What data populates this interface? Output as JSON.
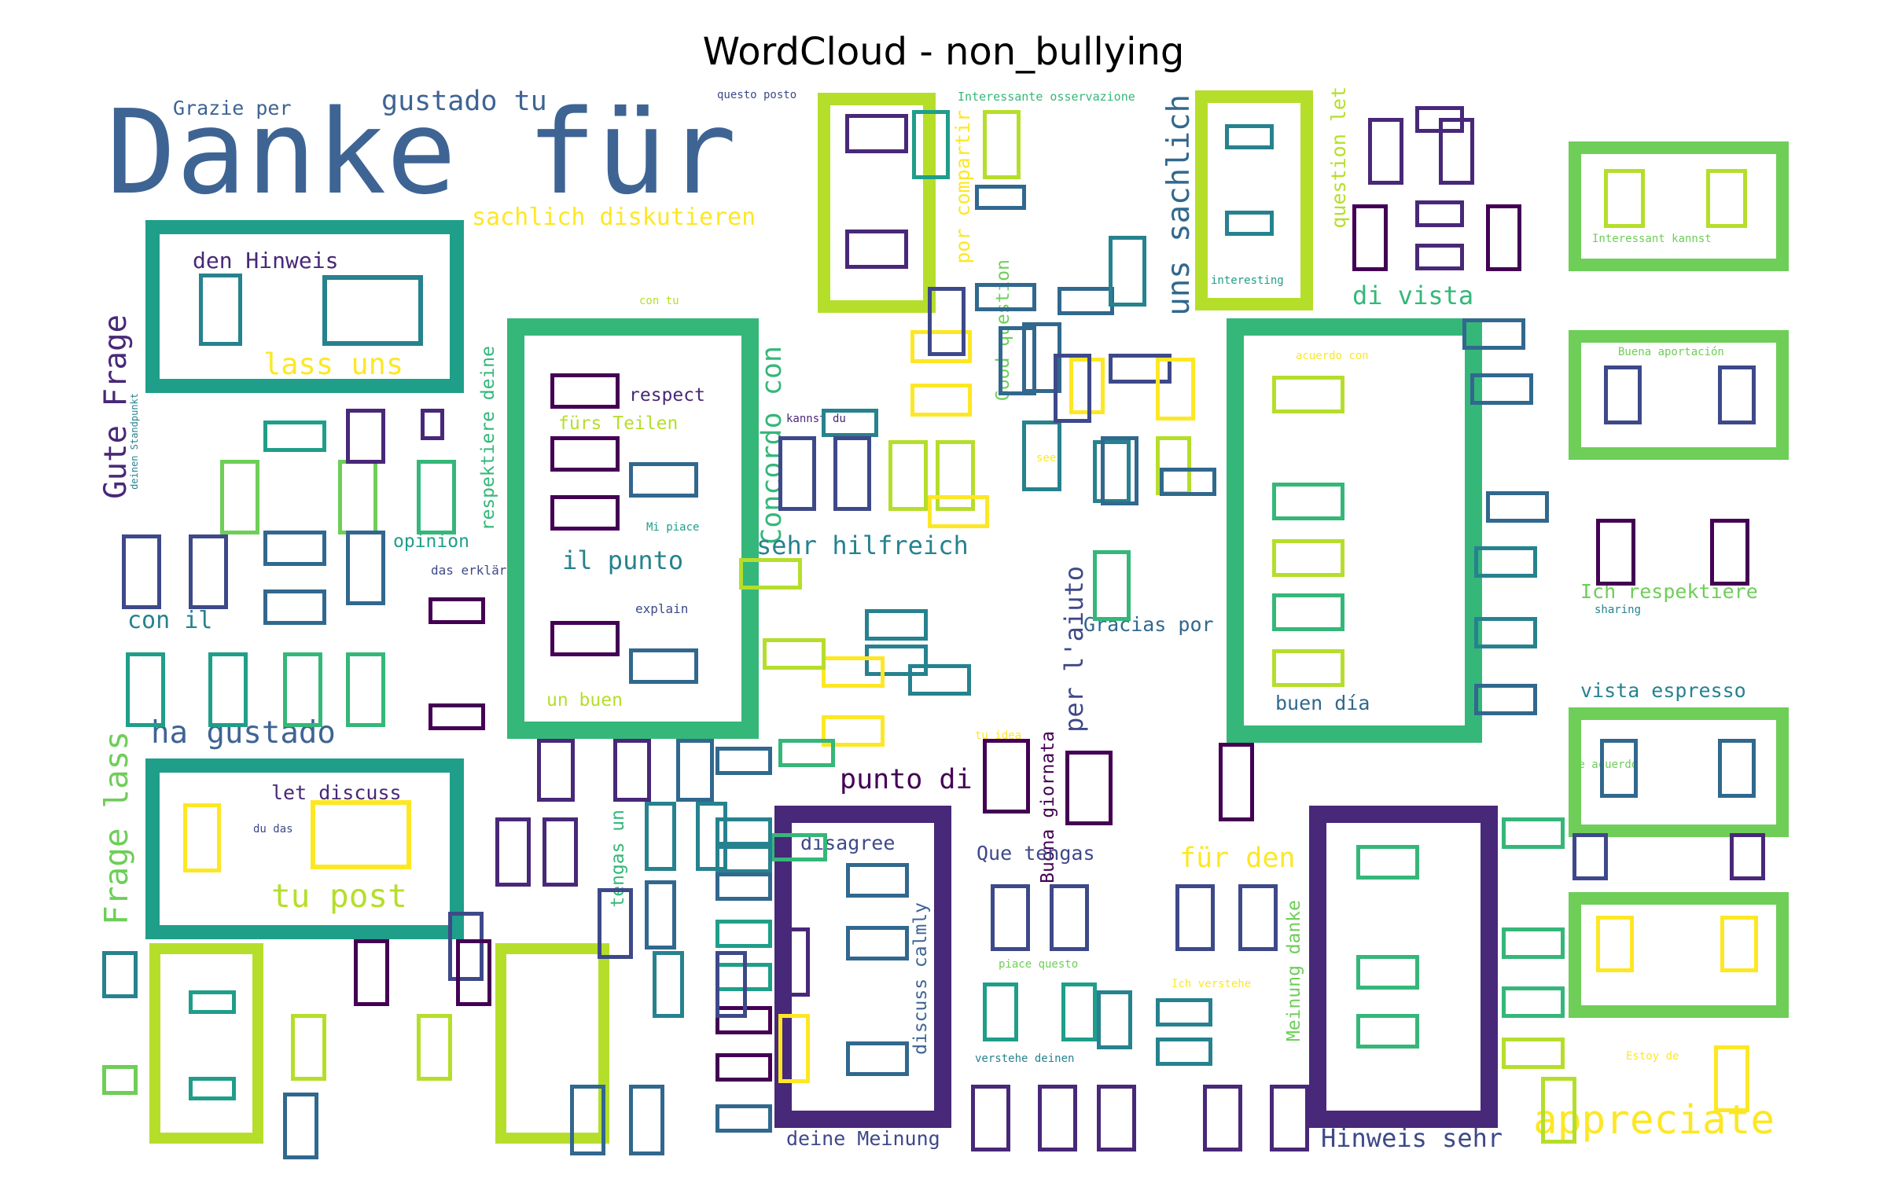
{
  "chart_data": {
    "type": "wordcloud",
    "title": "WordCloud - non_bullying",
    "palette": [
      "#440154",
      "#482878",
      "#3e4989",
      "#31688e",
      "#26828e",
      "#1f9e89",
      "#35b779",
      "#6ece58",
      "#b5de2b",
      "#fde725"
    ],
    "words": [
      {
        "text": "Danke für",
        "weight": 100,
        "color": "#3e6494",
        "orientation": "h"
      },
      {
        "text": "gustado tu",
        "weight": 30,
        "color": "#3e6494",
        "orientation": "h"
      },
      {
        "text": "Grazie per",
        "weight": 22,
        "color": "#3e6494",
        "orientation": "h"
      },
      {
        "text": "sachlich diskutieren",
        "weight": 26,
        "color": "#fde725",
        "orientation": "h"
      },
      {
        "text": "den Hinweis",
        "weight": 24,
        "color": "#482878",
        "orientation": "h"
      },
      {
        "text": "lass uns",
        "weight": 32,
        "color": "#fde725",
        "orientation": "h"
      },
      {
        "text": "Gute Frage",
        "weight": 34,
        "color": "#482878",
        "orientation": "v"
      },
      {
        "text": "respect",
        "weight": 20,
        "color": "#482878",
        "orientation": "h"
      },
      {
        "text": "fürs Teilen",
        "weight": 20,
        "color": "#b5de2b",
        "orientation": "h"
      },
      {
        "text": "Concordo con",
        "weight": 30,
        "color": "#35b779",
        "orientation": "v"
      },
      {
        "text": "il punto",
        "weight": 28,
        "color": "#26828e",
        "orientation": "h"
      },
      {
        "text": "sehr hilfreich",
        "weight": 28,
        "color": "#26828e",
        "orientation": "h"
      },
      {
        "text": "uns sachlich",
        "weight": 34,
        "color": "#31688e",
        "orientation": "v"
      },
      {
        "text": "di vista",
        "weight": 28,
        "color": "#35b779",
        "orientation": "h"
      },
      {
        "text": "question let",
        "weight": 22,
        "color": "#b5de2b",
        "orientation": "v"
      },
      {
        "text": "por compartir",
        "weight": 22,
        "color": "#fde725",
        "orientation": "v"
      },
      {
        "text": "Good question",
        "weight": 20,
        "color": "#6ece58",
        "orientation": "v"
      },
      {
        "text": "respektiere deine",
        "weight": 20,
        "color": "#35b779",
        "orientation": "v"
      },
      {
        "text": "opinion",
        "weight": 20,
        "color": "#1f9e89",
        "orientation": "h"
      },
      {
        "text": "con il",
        "weight": 26,
        "color": "#26828e",
        "orientation": "h"
      },
      {
        "text": "ha gustado",
        "weight": 34,
        "color": "#3e6494",
        "orientation": "h"
      },
      {
        "text": "Frage lass",
        "weight": 36,
        "color": "#6ece58",
        "orientation": "v"
      },
      {
        "text": "let discuss",
        "weight": 22,
        "color": "#482878",
        "orientation": "h"
      },
      {
        "text": "tu post",
        "weight": 36,
        "color": "#b5de2b",
        "orientation": "h"
      },
      {
        "text": "un buen",
        "weight": 20,
        "color": "#b5de2b",
        "orientation": "h"
      },
      {
        "text": "punto di",
        "weight": 30,
        "color": "#440154",
        "orientation": "h"
      },
      {
        "text": "per l'aiuto",
        "weight": 28,
        "color": "#3e4989",
        "orientation": "v"
      },
      {
        "text": "Gracias por",
        "weight": 22,
        "color": "#31688e",
        "orientation": "h"
      },
      {
        "text": "Buona giornata",
        "weight": 20,
        "color": "#440154",
        "orientation": "v"
      },
      {
        "text": "Que tengas",
        "weight": 22,
        "color": "#3e4989",
        "orientation": "h"
      },
      {
        "text": "für den",
        "weight": 30,
        "color": "#fde725",
        "orientation": "h"
      },
      {
        "text": "disagree",
        "weight": 22,
        "color": "#3e4989",
        "orientation": "h"
      },
      {
        "text": "discuss calmly",
        "weight": 20,
        "color": "#3e6494",
        "orientation": "v"
      },
      {
        "text": "tengas un",
        "weight": 20,
        "color": "#35b779",
        "orientation": "v"
      },
      {
        "text": "Meinung danke",
        "weight": 20,
        "color": "#6ece58",
        "orientation": "v"
      },
      {
        "text": "deine Meinung",
        "weight": 22,
        "color": "#3e4989",
        "orientation": "h"
      },
      {
        "text": "Hinweis sehr",
        "weight": 28,
        "color": "#3e4989",
        "orientation": "h"
      },
      {
        "text": "appreciate",
        "weight": 44,
        "color": "#fde725",
        "orientation": "h"
      },
      {
        "text": "buen día",
        "weight": 22,
        "color": "#31688e",
        "orientation": "h"
      },
      {
        "text": "Ich respektiere",
        "weight": 22,
        "color": "#6ece58",
        "orientation": "h"
      },
      {
        "text": "vista espresso",
        "weight": 22,
        "color": "#26828e",
        "orientation": "h"
      },
      {
        "text": "explain",
        "weight": 14,
        "color": "#3e4989",
        "orientation": "h"
      },
      {
        "text": "Mi piace",
        "weight": 12,
        "color": "#1f9e89",
        "orientation": "h"
      },
      {
        "text": "kannst du",
        "weight": 12,
        "color": "#482878",
        "orientation": "h"
      },
      {
        "text": "das erklären",
        "weight": 14,
        "color": "#3e4989",
        "orientation": "h"
      },
      {
        "text": "deinen Standpunkt",
        "weight": 10,
        "color": "#26828e",
        "orientation": "v"
      },
      {
        "text": "du das",
        "weight": 12,
        "color": "#3e4989",
        "orientation": "h"
      },
      {
        "text": "questo posto",
        "weight": 12,
        "color": "#3e4989",
        "orientation": "h"
      },
      {
        "text": "Interessante osservazione",
        "weight": 13,
        "color": "#35b779",
        "orientation": "h"
      },
      {
        "text": "interesting",
        "weight": 12,
        "color": "#1f9e89",
        "orientation": "h"
      },
      {
        "text": "con tu",
        "weight": 12,
        "color": "#b5de2b",
        "orientation": "h"
      },
      {
        "text": "Interessant kannst",
        "weight": 12,
        "color": "#6ece58",
        "orientation": "h"
      },
      {
        "text": "Buena aportación",
        "weight": 12,
        "color": "#6ece58",
        "orientation": "h"
      },
      {
        "text": "acuerdo con",
        "weight": 12,
        "color": "#fde725",
        "orientation": "h"
      },
      {
        "text": "sharing",
        "weight": 12,
        "color": "#26828e",
        "orientation": "h"
      },
      {
        "text": "see",
        "weight": 12,
        "color": "#fde725",
        "orientation": "h"
      },
      {
        "text": "tu idea",
        "weight": 12,
        "color": "#fde725",
        "orientation": "h"
      },
      {
        "text": "de acuerdo",
        "weight": 12,
        "color": "#6ece58",
        "orientation": "h"
      },
      {
        "text": "piace questo",
        "weight": 12,
        "color": "#6ece58",
        "orientation": "h"
      },
      {
        "text": "Ich verstehe",
        "weight": 12,
        "color": "#fde725",
        "orientation": "h"
      },
      {
        "text": "verstehe deinen",
        "weight": 12,
        "color": "#26828e",
        "orientation": "h"
      },
      {
        "text": "Estoy de",
        "weight": 12,
        "color": "#fde725",
        "orientation": "h"
      }
    ]
  }
}
